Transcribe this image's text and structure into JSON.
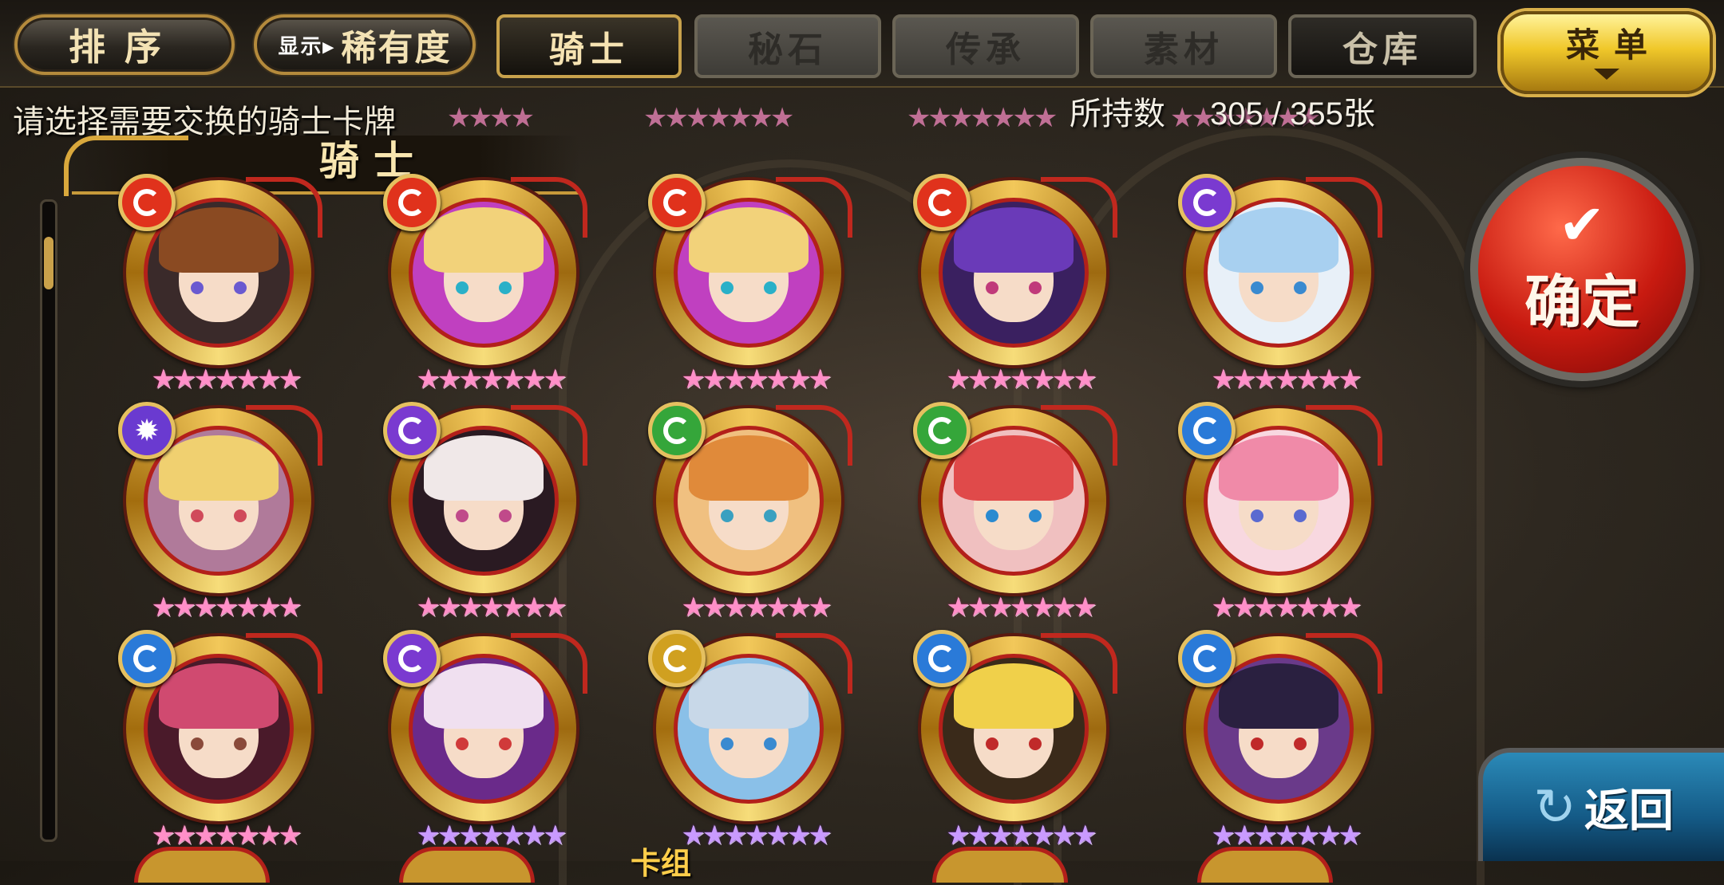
{
  "topbar": {
    "sort_label": "排序",
    "display_prefix": "显示▸",
    "display_value": "稀有度",
    "tabs": [
      {
        "label": "骑士",
        "state": "active"
      },
      {
        "label": "秘石",
        "state": "disabled"
      },
      {
        "label": "传承",
        "state": "disabled"
      },
      {
        "label": "素材",
        "state": "disabled"
      },
      {
        "label": "仓库",
        "state": "dark"
      }
    ],
    "menu_label": "菜单"
  },
  "prompt": "请选择需要交换的骑士卡牌",
  "owned": {
    "label": "所持数",
    "value": "305 / 355张"
  },
  "section_title": "骑士",
  "bottom_label": "卡组",
  "confirm_label": "确定",
  "back_label": "返回",
  "element_colors": {
    "fire": "#e0321c",
    "dark": "#7a3ad0",
    "wind": "#35a63a",
    "water": "#2a7ad8",
    "light": "#d0a020",
    "holy": "#6a3ad0"
  },
  "cards": [
    {
      "element": "fire",
      "stars": "★★★★★★★",
      "star_color": "pink",
      "hair": "#8a4a22",
      "eyes": "#6a5ad0",
      "bg": "#3a2a2a"
    },
    {
      "element": "fire",
      "stars": "★★★★★★★",
      "star_color": "pink",
      "hair": "#f2d27a",
      "eyes": "#2ab0c8",
      "bg": "#c040c0"
    },
    {
      "element": "fire",
      "stars": "★★★★★★★",
      "star_color": "pink",
      "hair": "#f2d27a",
      "eyes": "#2ab0c8",
      "bg": "#c040c0"
    },
    {
      "element": "fire",
      "stars": "★★★★★★★",
      "star_color": "pink",
      "hair": "#6a3ab8",
      "eyes": "#c03a7a",
      "bg": "#3a2060"
    },
    {
      "element": "dark",
      "stars": "★★★★★★★",
      "star_color": "pink",
      "hair": "#a8d0f0",
      "eyes": "#3a8ad0",
      "bg": "#e8f0f8"
    },
    {
      "element": "holy",
      "stars": "★★★★★★★",
      "star_color": "pink",
      "hair": "#f0d070",
      "eyes": "#d04a5a",
      "bg": "#b07a9a"
    },
    {
      "element": "dark",
      "stars": "★★★★★★★",
      "star_color": "pink",
      "hair": "#f0e8e8",
      "eyes": "#c04a8a",
      "bg": "#2a1a22"
    },
    {
      "element": "wind",
      "stars": "★★★★★★★",
      "star_color": "pink",
      "hair": "#e08a3a",
      "eyes": "#3aa0c0",
      "bg": "#f0c080"
    },
    {
      "element": "wind",
      "stars": "★★★★★★★",
      "star_color": "pink",
      "hair": "#e04a4a",
      "eyes": "#2a8ad0",
      "bg": "#f0c0c0"
    },
    {
      "element": "water",
      "stars": "★★★★★★★",
      "star_color": "pink",
      "hair": "#f08aa8",
      "eyes": "#5a6ad0",
      "bg": "#f8d8e0"
    },
    {
      "element": "water",
      "stars": "★★★★★★★",
      "star_color": "pink",
      "hair": "#d04a70",
      "eyes": "#8a4a3a",
      "bg": "#4a1a2a"
    },
    {
      "element": "dark",
      "stars": "★★★★★★★",
      "star_color": "violet",
      "hair": "#f0e0f0",
      "eyes": "#d03a3a",
      "bg": "#6a2a8a"
    },
    {
      "element": "light",
      "stars": "★★★★★★★",
      "star_color": "violet",
      "hair": "#c8d8e8",
      "eyes": "#3a8ad0",
      "bg": "#8ac0e8"
    },
    {
      "element": "water",
      "stars": "★★★★★★★",
      "star_color": "violet",
      "hair": "#f0d04a",
      "eyes": "#c02a2a",
      "bg": "#3a2a1a"
    },
    {
      "element": "water",
      "stars": "★★★★★★★",
      "star_color": "violet",
      "hair": "#2a2040",
      "eyes": "#c02a2a",
      "bg": "#6a3a8a"
    }
  ]
}
